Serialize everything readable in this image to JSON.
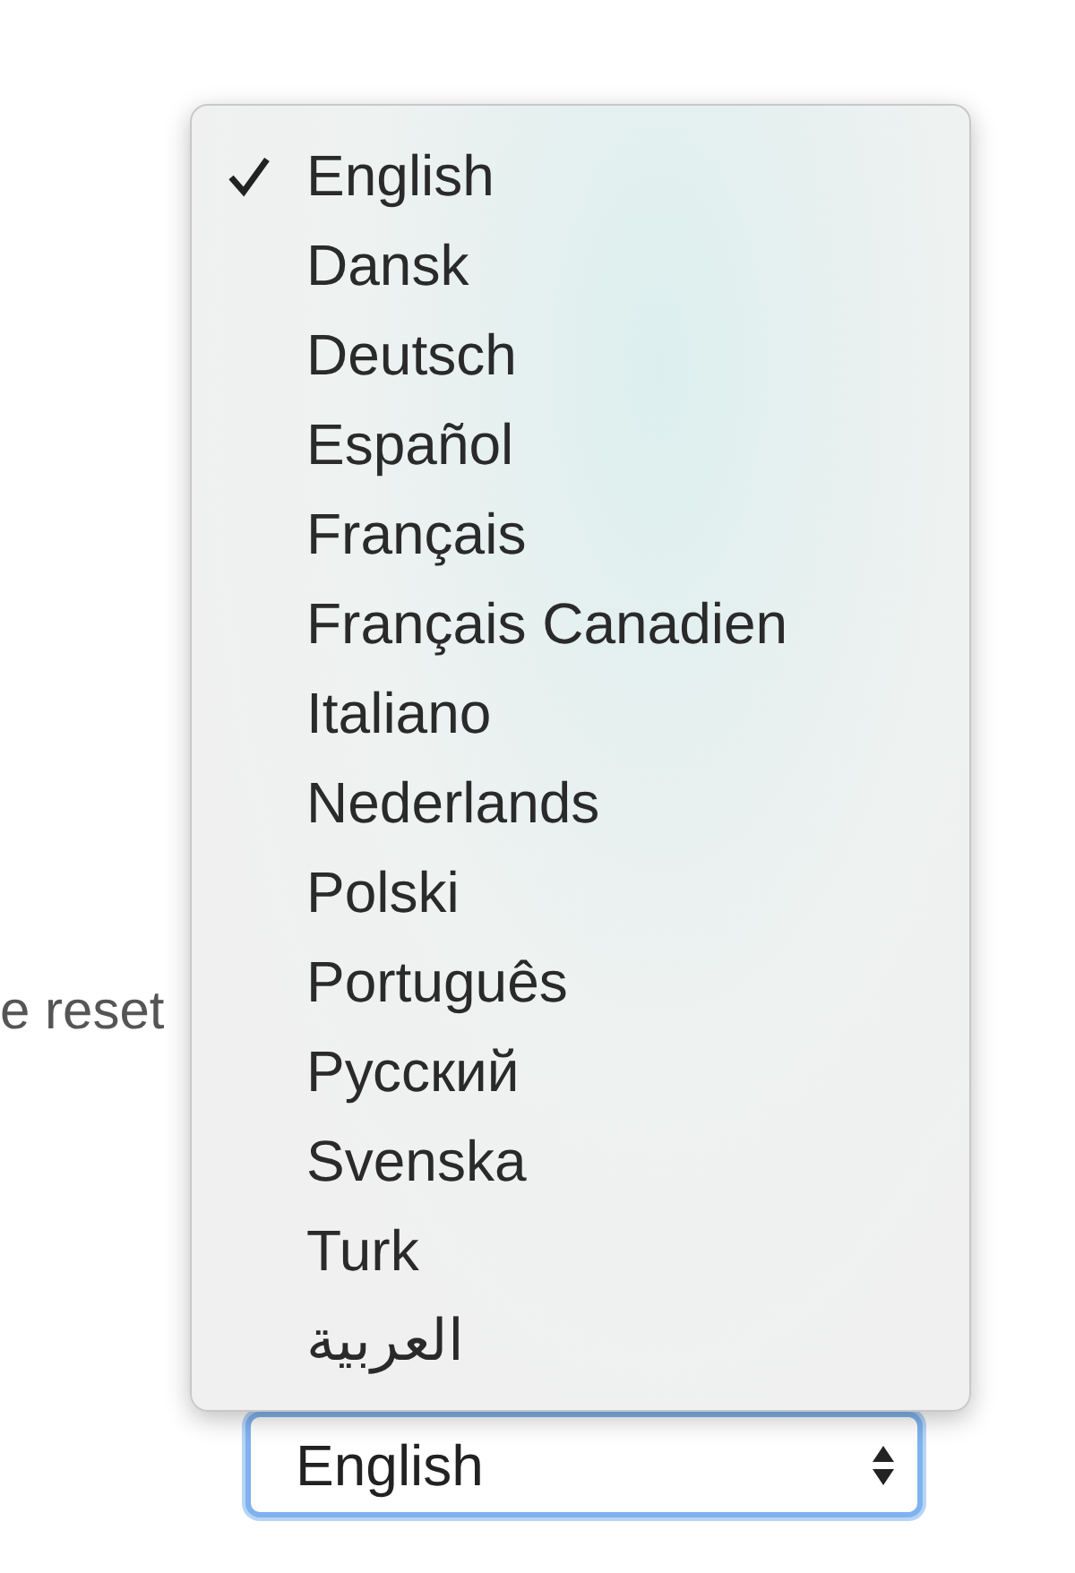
{
  "background_text": "e reset",
  "menu": {
    "items": [
      {
        "label": "English",
        "selected": true
      },
      {
        "label": "Dansk",
        "selected": false
      },
      {
        "label": "Deutsch",
        "selected": false
      },
      {
        "label": "Español",
        "selected": false
      },
      {
        "label": "Français",
        "selected": false
      },
      {
        "label": "Français Canadien",
        "selected": false
      },
      {
        "label": "Italiano",
        "selected": false
      },
      {
        "label": "Nederlands",
        "selected": false
      },
      {
        "label": "Polski",
        "selected": false
      },
      {
        "label": "Português",
        "selected": false
      },
      {
        "label": "Русский",
        "selected": false
      },
      {
        "label": "Svenska",
        "selected": false
      },
      {
        "label": "Turk",
        "selected": false
      },
      {
        "label": "العربية",
        "selected": false
      }
    ]
  },
  "select": {
    "value": "English",
    "focused": true
  }
}
